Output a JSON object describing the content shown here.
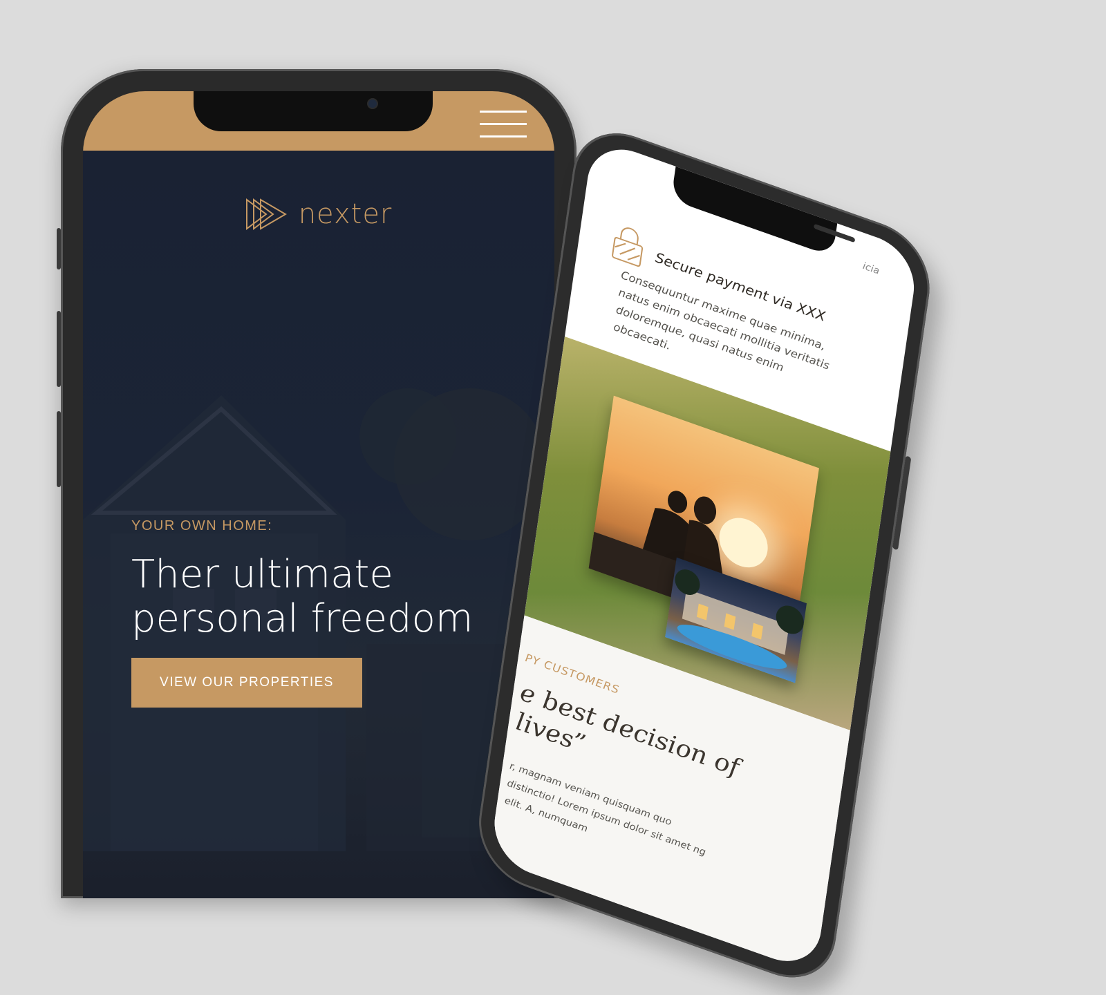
{
  "left_phone": {
    "brand": {
      "name": "nexter"
    },
    "hero": {
      "eyebrow": "YOUR OWN HOME:",
      "title_line1": "Ther ultimate",
      "title_line2": "personal freedom",
      "cta_label": "VIEW OUR PROPERTIES"
    }
  },
  "right_phone": {
    "feature": {
      "title": "Secure payment via XXX",
      "body": "Consequuntur maxime quae minima, natus enim obcaecati mollitia veritatis doloremque, quasi natus enim obcaecati."
    },
    "overflow_text": "icia",
    "testimonial": {
      "eyebrow": "PY CUSTOMERS",
      "quote_line1": "e best decision of",
      "quote_line2": "lives”",
      "body": "r, magnam veniam quisquam quo distinctio! Lorem ipsum dolor sit amet ng elit. A, numquam"
    }
  },
  "colors": {
    "gold": "#c69963",
    "navy": "#1b2333",
    "background": "#dcdcdc"
  }
}
